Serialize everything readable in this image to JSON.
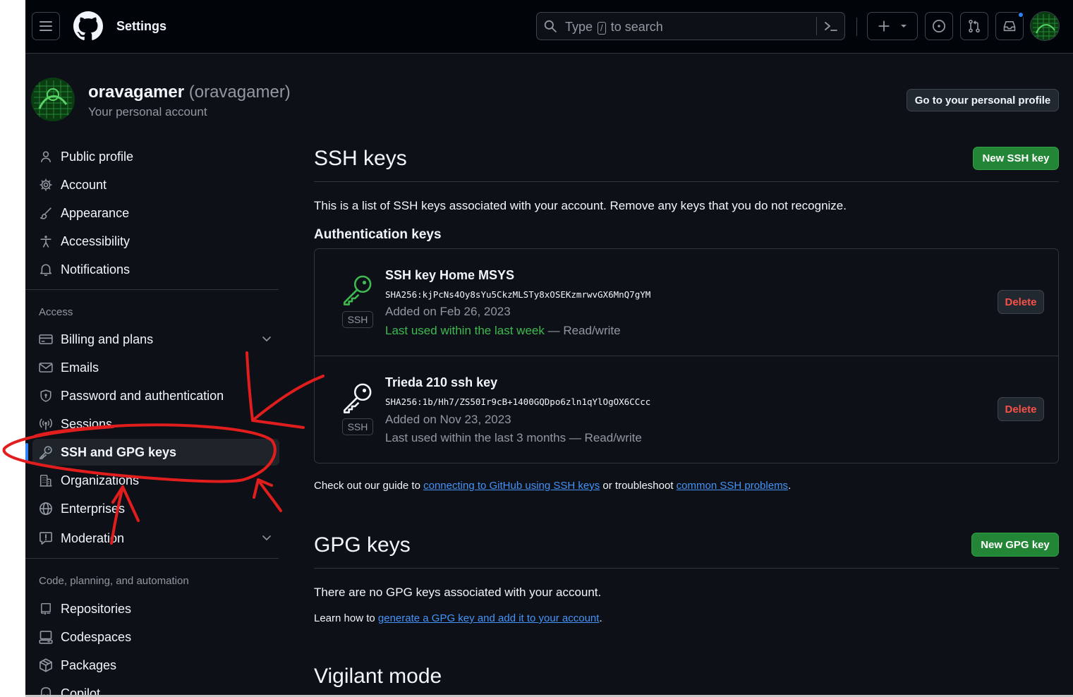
{
  "header": {
    "title": "Settings",
    "search": {
      "prefix": "Type",
      "key": "/",
      "suffix": "to search"
    },
    "icons": [
      "hamburger-icon",
      "github-logo-icon",
      "search-icon",
      "command-palette-icon",
      "plus-icon",
      "triangle-down-icon",
      "issue-icon",
      "pull-request-icon",
      "inbox-icon"
    ]
  },
  "profile": {
    "username": "oravagamer",
    "handle": "(oravagamer)",
    "subtitle": "Your personal account",
    "go_profile_button": "Go to your personal profile"
  },
  "sidebar": {
    "items_top": [
      {
        "label": "Public profile",
        "icon": "person-icon"
      },
      {
        "label": "Account",
        "icon": "gear-icon"
      },
      {
        "label": "Appearance",
        "icon": "paintbrush-icon"
      },
      {
        "label": "Accessibility",
        "icon": "accessibility-icon"
      },
      {
        "label": "Notifications",
        "icon": "bell-icon"
      }
    ],
    "group_access": "Access",
    "items_access": [
      {
        "label": "Billing and plans",
        "icon": "credit-card-icon"
      },
      {
        "label": "Emails",
        "icon": "mail-icon"
      },
      {
        "label": "Password and authentication",
        "icon": "shield-lock-icon"
      },
      {
        "label": "Sessions",
        "icon": "broadcast-icon"
      },
      {
        "label": "SSH and GPG keys",
        "icon": "key-icon"
      },
      {
        "label": "Organizations",
        "icon": "organization-icon"
      },
      {
        "label": "Enterprises",
        "icon": "globe-icon"
      },
      {
        "label": "Moderation",
        "icon": "report-icon"
      }
    ],
    "group_code": "Code, planning, and automation",
    "items_code": [
      {
        "label": "Repositories",
        "icon": "repo-icon"
      },
      {
        "label": "Codespaces",
        "icon": "codespaces-icon"
      },
      {
        "label": "Packages",
        "icon": "package-icon"
      },
      {
        "label": "Copilot",
        "icon": "copilot-icon"
      }
    ]
  },
  "ssh": {
    "title": "SSH keys",
    "new_button": "New SSH key",
    "description": "This is a list of SSH keys associated with your account. Remove any keys that you do not recognize.",
    "auth_heading": "Authentication keys",
    "keys": [
      {
        "title": "SSH key Home MSYS",
        "fingerprint": "SHA256:kjPcNs4Oy8sYu5CkzMLSTy8xOSEKzmrwvGX6MnQ7gYM",
        "added": "Added on Feb 26, 2023",
        "last_used": "Last used within the last week",
        "access": "— Read/write",
        "badge": "SSH",
        "delete_label": "Delete",
        "icon_color": "#3fb950"
      },
      {
        "title": "Trieda 210 ssh key",
        "fingerprint": "SHA256:1b/Hh7/ZS50Ir9cB+1400GQDpo6zln1qYlOgOX6CCcc",
        "added": "Added on Nov 23, 2023",
        "last_used": "Last used within the last 3 months",
        "access": "— Read/write",
        "badge": "SSH",
        "delete_label": "Delete",
        "icon_color": "#f0f6fc"
      }
    ],
    "guide_prefix": "Check out our guide to",
    "guide_link": "connecting to GitHub using SSH keys",
    "guide_middle": "or troubleshoot",
    "guide_link2": "common SSH problems",
    "guide_suffix": "."
  },
  "gpg": {
    "title": "GPG keys",
    "new_button": "New GPG key",
    "empty": "There are no GPG keys associated with your account.",
    "learn_prefix": "Learn how to",
    "learn_link": "generate a GPG key and add it to your account",
    "learn_suffix": "."
  },
  "vigilant": {
    "title": "Vigilant mode"
  },
  "colors": {
    "bg": "#0d1117",
    "header_bg": "#010409",
    "accent": "#2f81f7",
    "green": "#238636",
    "danger": "#f85149",
    "annotation": "#e11d1d"
  }
}
